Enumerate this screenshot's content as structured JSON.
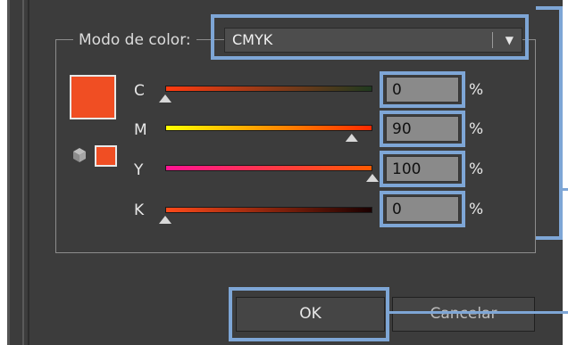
{
  "dialog": {
    "color_mode_label": "Modo de color:",
    "color_mode_value": "CMYK",
    "dropdown_arrow": "▼",
    "current_color": "#f04e23",
    "channels": [
      {
        "letter": "C",
        "value": "0",
        "unit": "%",
        "fraction": 0.0,
        "gradient": [
          "#ff3b10",
          "#1f3a1f"
        ]
      },
      {
        "letter": "M",
        "value": "90",
        "unit": "%",
        "fraction": 0.9,
        "gradient": [
          "#ffff00",
          "#ff2a00"
        ]
      },
      {
        "letter": "Y",
        "value": "100",
        "unit": "%",
        "fraction": 1.0,
        "gradient": [
          "#ff1493",
          "#ff5a00"
        ]
      },
      {
        "letter": "K",
        "value": "0",
        "unit": "%",
        "fraction": 0.0,
        "gradient": [
          "#ff4a1a",
          "#1a0000"
        ]
      }
    ],
    "ok_label": "OK",
    "cancel_label": "Cancelar",
    "highlight_color": "#7ea6d6"
  }
}
